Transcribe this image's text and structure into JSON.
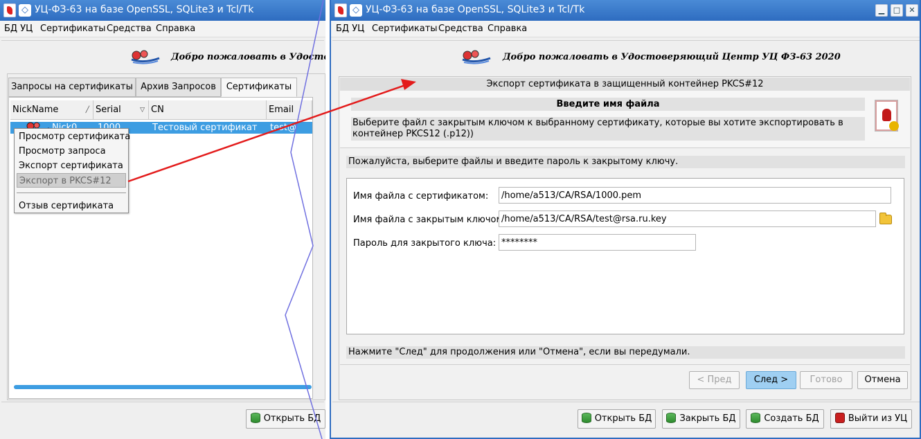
{
  "colors": {
    "titlebar": "#3a7bcf",
    "selection": "#3d9de2",
    "primary_button": "#9fcff2",
    "arrow": "#e31b1b",
    "divider": "#7070e0"
  },
  "left_window": {
    "title": "УЦ-ФЗ-63 на базе OpenSSL, SQLite3 и Tcl/Tk",
    "menu": [
      "БД УЦ",
      "Сертификаты",
      "Средства",
      "Справка"
    ],
    "welcome": "Добро пожаловать в Удостове",
    "tabs": [
      "Запросы на сертификаты",
      "Архив Запросов",
      "Сертификаты"
    ],
    "active_tab": "Сертификаты",
    "columns": [
      "NickName",
      "Serial",
      "CN",
      "Email"
    ],
    "selected_row": {
      "nickname": "Nick0",
      "serial": "1000",
      "cn": "Тестовый сертификат",
      "email": "test@"
    },
    "context_menu": [
      "Просмотр сертификата",
      "Просмотр запроса",
      "Экспорт сертификата",
      "Экспорт в PKCS#12",
      "Отзыв сертификата"
    ],
    "highlighted_item": "Экспорт в PKCS#12",
    "bottom_button": "Открыть БД"
  },
  "right_window": {
    "title": "УЦ-ФЗ-63 на базе OpenSSL, SQLite3 и Tcl/Tk",
    "menu": [
      "БД УЦ",
      "Сертификаты",
      "Средства",
      "Справка"
    ],
    "welcome": "Добро пожаловать в Удостоверяющий Центр УЦ ФЗ-63 2020",
    "wizard": {
      "title": "Экспорт сертификата в защищенный контейнер PKCS#12",
      "step_heading": "Введите имя файла",
      "step_description": "Выберите файл с закрытым ключом к выбранному сертификату, которые вы хотите экспортировать в контейнер PKCS12 (.p12))",
      "instruction": "Пожалуйста, выберите файлы и введите пароль к закрытому ключу.",
      "fields": {
        "cert_label": "Имя файла с сертификатом:",
        "cert_value": "/home/a513/CA/RSA/1000.pem",
        "key_label": "Имя файла с закрытым ключом:",
        "key_value": "/home/a513/CA/RSA/test@rsa.ru.key",
        "password_label": "Пароль для закрытого ключа:",
        "password_value": "********"
      },
      "hint": "Нажмите \"След\" для продолжения или \"Отмена\", если вы передумали.",
      "buttons": {
        "prev": "< Пред",
        "next": "След >",
        "finish": "Готово",
        "cancel": "Отмена"
      }
    },
    "bottom_buttons": {
      "open_db": "Открыть БД",
      "close_db": "Закрыть БД",
      "create_db": "Создать БД",
      "exit": "Выйти из УЦ"
    }
  }
}
